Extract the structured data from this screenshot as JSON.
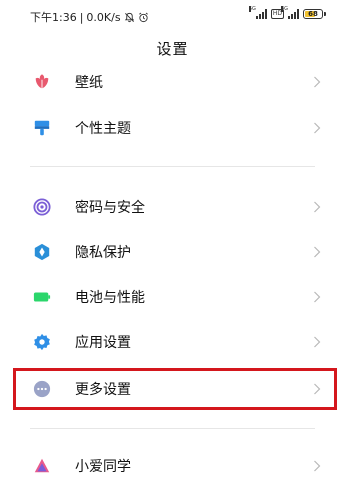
{
  "status_bar": {
    "time": "下午1:36",
    "speed": "0.0K/s",
    "net_tag_1": "5G",
    "net_tag_2": "4G",
    "hd_label": "HD",
    "battery": "68",
    "battery_fraction": 0.68,
    "battery_color": "#f2c230"
  },
  "page": {
    "title": "设置"
  },
  "items": [
    {
      "label": "壁纸",
      "icon": "wallpaper-icon",
      "color": "#e8596e"
    },
    {
      "label": "个性主题",
      "icon": "theme-brush-icon",
      "color": "#2f8fe6"
    },
    {
      "label": "密码与安全",
      "icon": "security-icon",
      "color": "#7b5fd6"
    },
    {
      "label": "隐私保护",
      "icon": "privacy-icon",
      "color": "#2a8fd8"
    },
    {
      "label": "电池与性能",
      "icon": "battery-icon",
      "color": "#2bd66b"
    },
    {
      "label": "应用设置",
      "icon": "gear-icon",
      "color": "#2f8fe6"
    },
    {
      "label": "更多设置",
      "icon": "more-icon",
      "color": "#9aa3c7"
    },
    {
      "label": "小爱同学",
      "icon": "xiaoai-icon",
      "color": "#e85a8c"
    }
  ],
  "highlight_color": "#d4171d"
}
